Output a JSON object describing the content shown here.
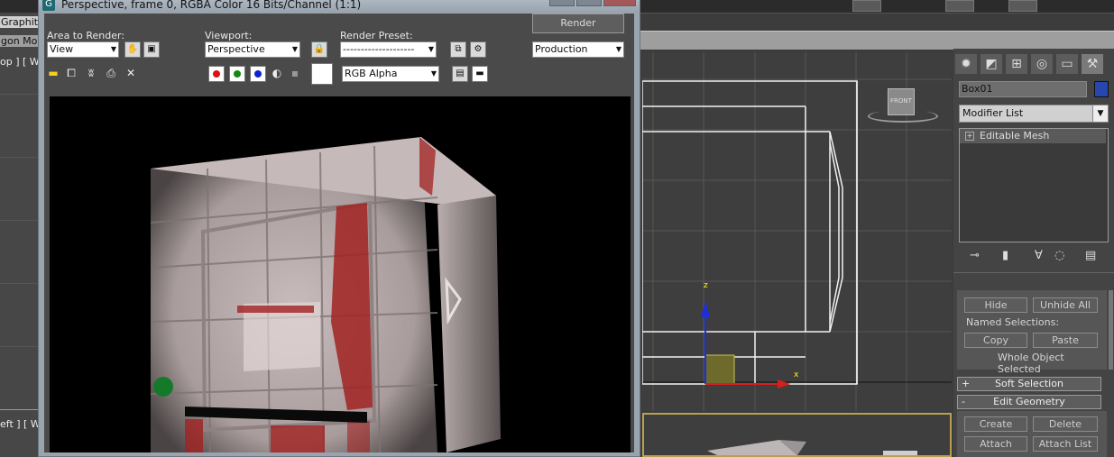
{
  "render_window": {
    "title": "Perspective, frame 0, RGBA Color 16 Bits/Channel (1:1)",
    "area_label": "Area to Render:",
    "area_value": "View",
    "viewport_label": "Viewport:",
    "viewport_value": "Perspective",
    "preset_label": "Render Preset:",
    "preset_value": "--------------------",
    "render_button": "Render",
    "production_value": "Production",
    "channel_value": "RGB Alpha"
  },
  "background": {
    "graphite_label": "Graphite",
    "polygon_label": "gon Mo",
    "top_vp_label": "op ] [ W",
    "left_vp_label": "eft ] [ W",
    "viewcube_label": "FRONT",
    "axis_z": "z",
    "axis_x": "x"
  },
  "command_panel": {
    "object_name": "Box01",
    "object_color": "#2746b0",
    "modifier_list": "Modifier List",
    "stack_item": "Editable Mesh",
    "hide": "Hide",
    "unhide_all": "Unhide All",
    "named_selections": "Named Selections:",
    "copy": "Copy",
    "paste": "Paste",
    "whole_object": "Whole Object Selected",
    "soft_selection": "Soft Selection",
    "soft_sign": "+",
    "edit_geometry": "Edit Geometry",
    "edit_sign": "-",
    "create": "Create",
    "delete": "Delete",
    "attach": "Attach",
    "attach_list": "Attach List"
  }
}
